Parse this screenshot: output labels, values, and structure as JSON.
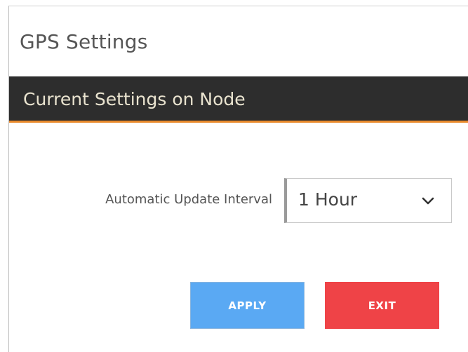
{
  "dialog": {
    "title": "GPS Settings"
  },
  "section": {
    "header": "Current Settings on Node"
  },
  "form": {
    "interval_label": "Automatic Update Interval",
    "interval_value": "1 Hour",
    "interval_icon": "chevron-down-icon"
  },
  "buttons": {
    "apply_label": "APPLY",
    "exit_label": "EXIT"
  },
  "colors": {
    "header_background": "#2d2d2d",
    "header_accent": "#e98a2c",
    "apply_button": "#5aa9f3",
    "exit_button": "#ef4347"
  }
}
